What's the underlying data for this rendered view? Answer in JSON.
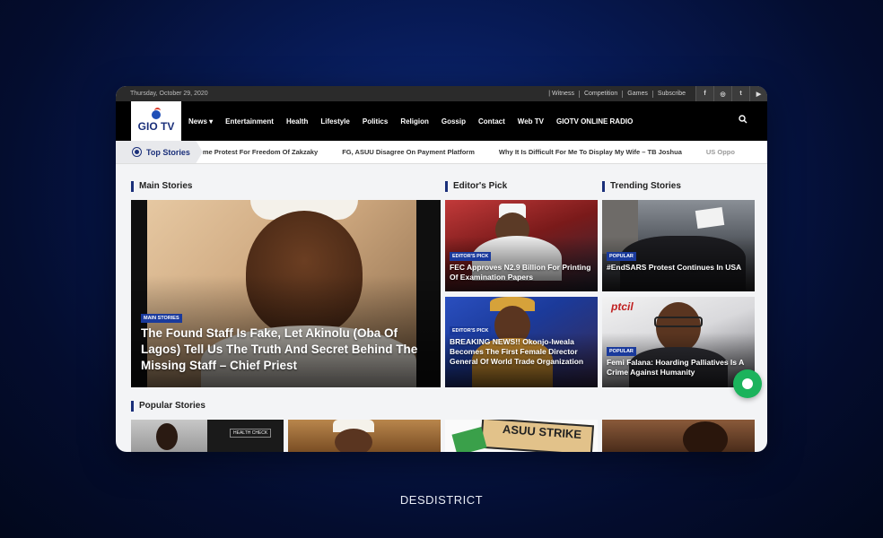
{
  "topbar": {
    "date": "Thursday, October 29, 2020",
    "links": [
      "| Witness",
      "Competition",
      "Games",
      "Subscribe"
    ],
    "social": [
      "f",
      "◎",
      "t",
      "▶"
    ]
  },
  "nav": {
    "logo": "GIO TV",
    "items": [
      "News ▾",
      "Entertainment",
      "Health",
      "Lifestyle",
      "Politics",
      "Religion",
      "Gossip",
      "Contact",
      "Web TV",
      "GIOTV ONLINE RADIO"
    ]
  },
  "ticker": {
    "label": "Top Stories",
    "items": [
      "me Protest For Freedom Of Zakzaky",
      "FG, ASUU Disagree On Payment Platform",
      "Why It Is Difficult For Me To Display My Wife – TB Joshua",
      "US Oppo"
    ]
  },
  "sections": {
    "main": "Main Stories",
    "editors": "Editor's Pick",
    "trending": "Trending Stories",
    "popular": "Popular Stories"
  },
  "main_story": {
    "badge": "MAIN STORIES",
    "title": "The Found Staff Is Fake, Let Akinolu (Oba Of Lagos) Tell Us The Truth And Secret Behind The Missing Staff – Chief Priest"
  },
  "editors_pick": [
    {
      "badge": "EDITOR'S PICK",
      "title": "FEC Approves N2.9 Billion For Printing Of Examination Papers"
    },
    {
      "badge": "EDITOR'S PICK",
      "title": "BREAKING NEWS!! Okonjo-Iweala Becomes The First Female Director General Of World Trade Organization"
    }
  ],
  "trending": [
    {
      "badge": "POPULAR",
      "title": "#EndSARS Protest Continues In USA"
    },
    {
      "badge": "POPULAR",
      "title": "Femi Falana: Hoarding Palliatives Is A Crime Against Humanity"
    }
  ],
  "popular_thumbs": {
    "health_check": "HEALTH CHECK",
    "asuu_text": "ASUU STRIKE",
    "ptcil": "ptcil"
  },
  "footer": {
    "brand": "DESDISTRICT"
  },
  "colors": {
    "accent": "#1a2f7a",
    "badge": "#1a3a9c",
    "chat": "#1bb35c"
  }
}
